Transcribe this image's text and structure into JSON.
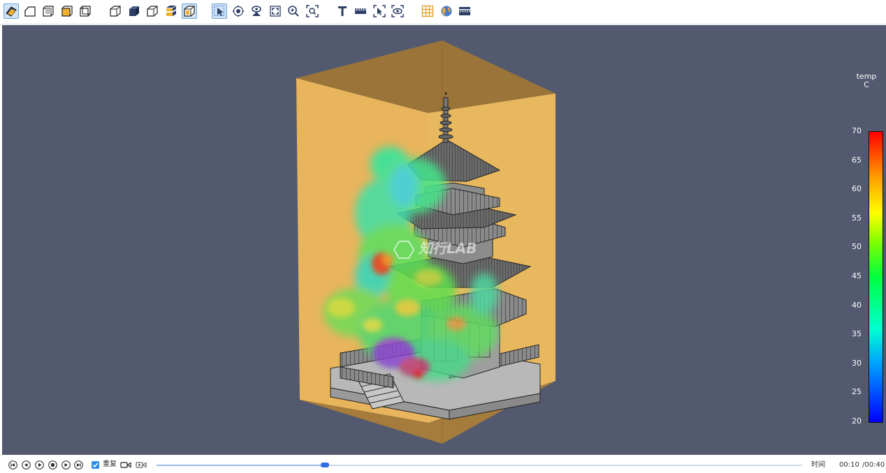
{
  "toolbar": {
    "groups": [
      [
        "open-file-button",
        "reset-model-button",
        "view-box-button",
        "view-box-colored-button",
        "wire-box-button"
      ],
      [
        "wireframe-cube-button",
        "solid-cube-button",
        "outline-cube-button",
        "layer-slice-button",
        "outline-box-button"
      ],
      [
        "select-pointer-button",
        "orbit-button",
        "pan-view-button",
        "fit-view-button",
        "zoom-button",
        "zoom-box-button"
      ],
      [
        "text-annotation-button",
        "ruler-button",
        "pick-select-button",
        "visibility-button"
      ],
      [
        "grid-button",
        "globe-view-button",
        "scale-bar-button"
      ]
    ],
    "active": [
      "open-file-button",
      "outline-box-button",
      "select-pointer-button"
    ]
  },
  "colorbar": {
    "title_line1": "temp",
    "title_line2": "C",
    "min": 20,
    "max": 70,
    "ticks": [
      "70",
      "65",
      "60",
      "55",
      "50",
      "45",
      "40",
      "35",
      "30",
      "25",
      "20"
    ]
  },
  "watermark": {
    "text": "知行LAB",
    "badge": "LAB"
  },
  "playback": {
    "repeat_label": "重复",
    "repeat_checked": true,
    "progress": 0.261,
    "time_label": "时间",
    "current_time": "00:10",
    "total_time": "/00:40"
  },
  "colors": {
    "viewport_bg": "#535a6f",
    "box_face": "#e6b35c",
    "accent": "#2e6fe6"
  }
}
